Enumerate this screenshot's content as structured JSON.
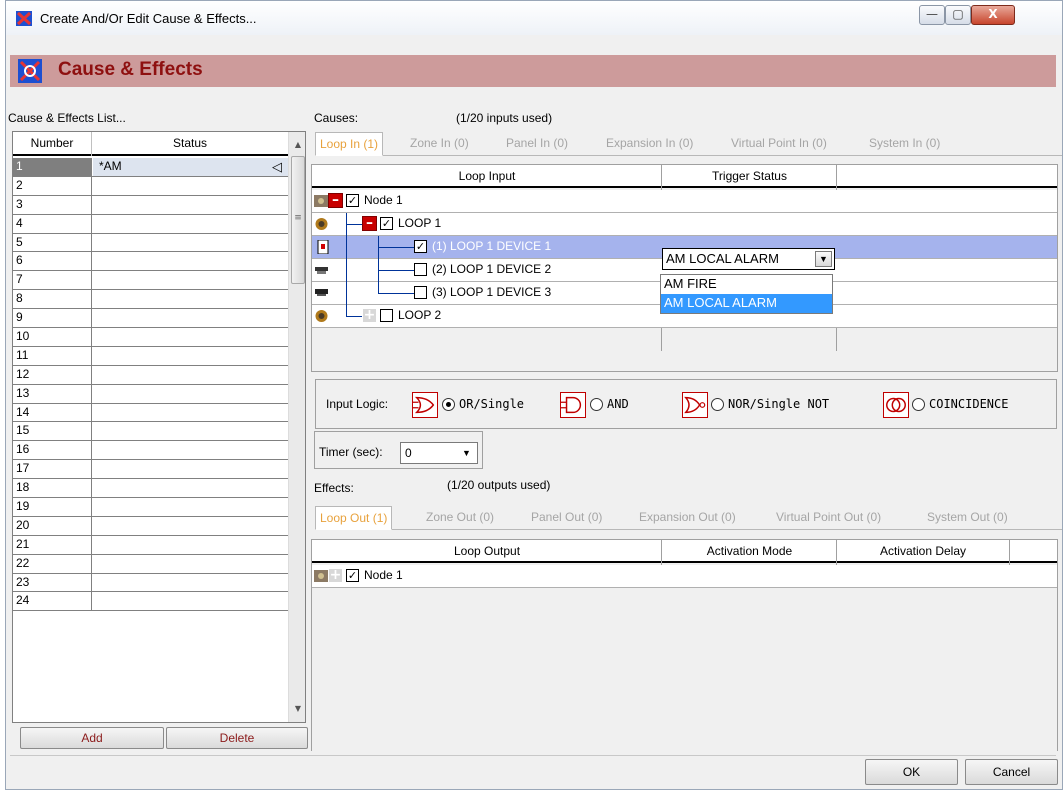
{
  "window": {
    "title": "Create And/Or Edit Cause & Effects...",
    "controls": {
      "minimize": "—",
      "maximize": "▢",
      "close": "X"
    }
  },
  "header": {
    "title": "Cause & Effects"
  },
  "list": {
    "label": "Cause & Effects List...",
    "col_number": "Number",
    "col_status": "Status",
    "rows": [
      {
        "num": "1",
        "status": "*AM"
      },
      {
        "num": "2",
        "status": ""
      },
      {
        "num": "3",
        "status": ""
      },
      {
        "num": "4",
        "status": ""
      },
      {
        "num": "5",
        "status": ""
      },
      {
        "num": "6",
        "status": ""
      },
      {
        "num": "7",
        "status": ""
      },
      {
        "num": "8",
        "status": ""
      },
      {
        "num": "9",
        "status": ""
      },
      {
        "num": "10",
        "status": ""
      },
      {
        "num": "11",
        "status": ""
      },
      {
        "num": "12",
        "status": ""
      },
      {
        "num": "13",
        "status": ""
      },
      {
        "num": "14",
        "status": ""
      },
      {
        "num": "15",
        "status": ""
      },
      {
        "num": "16",
        "status": ""
      },
      {
        "num": "17",
        "status": ""
      },
      {
        "num": "18",
        "status": ""
      },
      {
        "num": "19",
        "status": ""
      },
      {
        "num": "20",
        "status": ""
      },
      {
        "num": "21",
        "status": ""
      },
      {
        "num": "22",
        "status": ""
      },
      {
        "num": "23",
        "status": ""
      },
      {
        "num": "24",
        "status": ""
      }
    ],
    "add_label": "Add",
    "delete_label": "Delete"
  },
  "causes": {
    "label": "Causes:",
    "usage": "(1/20 inputs used)",
    "tabs": [
      {
        "label": "Loop In (1)",
        "active": true
      },
      {
        "label": "Zone In (0)",
        "active": false
      },
      {
        "label": "Panel In (0)",
        "active": false
      },
      {
        "label": "Expansion In (0)",
        "active": false
      },
      {
        "label": "Virtual Point In (0)",
        "active": false
      },
      {
        "label": "System In (0)",
        "active": false
      }
    ],
    "col_input": "Loop Input",
    "col_trigger": "Trigger Status",
    "rows": {
      "node1": "Node 1",
      "loop1": "LOOP 1",
      "dev1": "(1) LOOP 1 DEVICE 1",
      "dev2": "(2) LOOP 1 DEVICE 2",
      "dev3": "(3) LOOP 1 DEVICE 3",
      "loop2": "LOOP 2"
    },
    "trigger_value": "AM LOCAL ALARM",
    "trigger_options": [
      "AM FIRE",
      "AM LOCAL ALARM"
    ]
  },
  "input_logic": {
    "label": "Input Logic:",
    "options": [
      {
        "label": "OR/Single",
        "selected": true
      },
      {
        "label": "AND",
        "selected": false
      },
      {
        "label": "NOR/Single NOT",
        "selected": false
      },
      {
        "label": "COINCIDENCE",
        "selected": false
      }
    ]
  },
  "timer": {
    "label": "Timer (sec):",
    "value": "0"
  },
  "effects": {
    "label": "Effects:",
    "usage": "(1/20 outputs used)",
    "tabs": [
      {
        "label": "Loop Out (1)",
        "active": true
      },
      {
        "label": "Zone Out (0)",
        "active": false
      },
      {
        "label": "Panel Out (0)",
        "active": false
      },
      {
        "label": "Expansion Out (0)",
        "active": false
      },
      {
        "label": "Virtual Point Out (0)",
        "active": false
      },
      {
        "label": "System Out (0)",
        "active": false
      }
    ],
    "col_output": "Loop Output",
    "col_mode": "Activation Mode",
    "col_delay": "Activation Delay",
    "rows": {
      "node1": "Node 1"
    }
  },
  "footer": {
    "ok_label": "OK",
    "cancel_label": "Cancel"
  },
  "colors": {
    "banner": "#cd9b9b",
    "heading": "#8e1010",
    "selection": "#a5b3ed",
    "active_tab": "#e8a23d",
    "dropdown_highlight": "#3399ff"
  }
}
